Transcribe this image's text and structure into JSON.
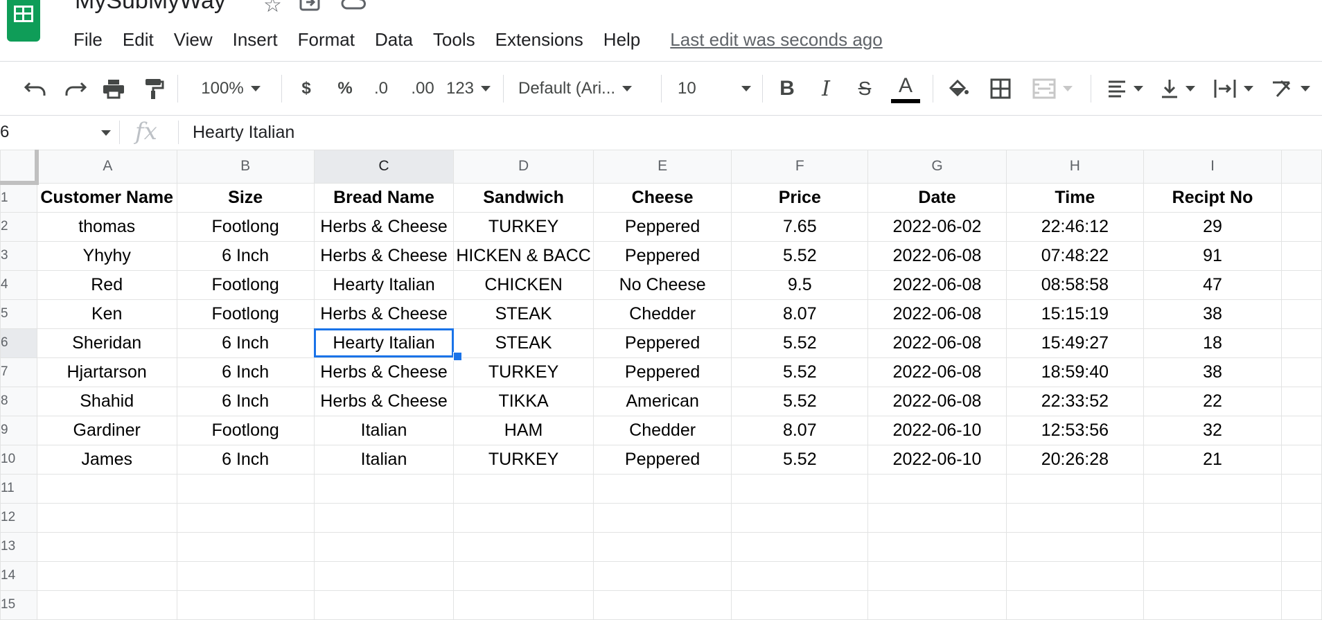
{
  "app": {
    "title": "MySubMyWay",
    "menu": [
      "File",
      "Edit",
      "View",
      "Insert",
      "Format",
      "Data",
      "Tools",
      "Extensions",
      "Help"
    ],
    "last_edit": "Last edit was seconds ago"
  },
  "toolbar": {
    "zoom": "100%",
    "currency": "$",
    "percent": "%",
    "decrease_decimal": ".0",
    "increase_decimal": ".00",
    "more_formats": "123",
    "font": "Default (Ari...",
    "font_size": "10",
    "bold": "B",
    "italic": "I",
    "strikethrough": "S",
    "text_color": "A"
  },
  "formula_bar": {
    "cell_ref": "6",
    "fx": "fx",
    "value": "Hearty Italian"
  },
  "grid": {
    "columns": [
      "A",
      "B",
      "C",
      "D",
      "E",
      "F",
      "G",
      "H",
      "I"
    ],
    "selected_column": "C",
    "selected_row": "6",
    "row_numbers": [
      "1",
      "2",
      "3",
      "4",
      "5",
      "6",
      "7",
      "8",
      "9",
      "10",
      "11",
      "12",
      "13",
      "14",
      "15"
    ],
    "rows": [
      [
        "Customer Name",
        "Size",
        "Bread Name",
        "Sandwich",
        "Cheese",
        "Price",
        "Date",
        "Time",
        "Recipt No"
      ],
      [
        "thomas",
        "Footlong",
        "Herbs & Cheese",
        "TURKEY",
        "Peppered",
        "7.65",
        "2022-06-02",
        "22:46:12",
        "29"
      ],
      [
        "Yhyhy",
        "6 Inch",
        "Herbs & Cheese",
        "HICKEN & BACC",
        "Peppered",
        "5.52",
        "2022-06-08",
        "07:48:22",
        "91"
      ],
      [
        "Red",
        "Footlong",
        "Hearty Italian",
        "CHICKEN",
        "No Cheese",
        "9.5",
        "2022-06-08",
        "08:58:58",
        "47"
      ],
      [
        "Ken",
        "Footlong",
        "Herbs & Cheese",
        "STEAK",
        "Chedder",
        "8.07",
        "2022-06-08",
        "15:15:19",
        "38"
      ],
      [
        "Sheridan",
        "6 Inch",
        "Hearty Italian",
        "STEAK",
        "Peppered",
        "5.52",
        "2022-06-08",
        "15:49:27",
        "18"
      ],
      [
        "Hjartarson",
        "6 Inch",
        "Herbs & Cheese",
        "TURKEY",
        "Peppered",
        "5.52",
        "2022-06-08",
        "18:59:40",
        "38"
      ],
      [
        "Shahid",
        "6 Inch",
        "Herbs & Cheese",
        "TIKKA",
        "American",
        "5.52",
        "2022-06-08",
        "22:33:52",
        "22"
      ],
      [
        "Gardiner",
        "Footlong",
        "Italian",
        "HAM",
        "Chedder",
        "8.07",
        "2022-06-10",
        "12:53:56",
        "32"
      ],
      [
        "James",
        "6 Inch",
        "Italian",
        "TURKEY",
        "Peppered",
        "5.52",
        "2022-06-10",
        "20:26:28",
        "21"
      ],
      [
        "",
        "",
        "",
        "",
        "",
        "",
        "",
        "",
        ""
      ],
      [
        "",
        "",
        "",
        "",
        "",
        "",
        "",
        "",
        ""
      ],
      [
        "",
        "",
        "",
        "",
        "",
        "",
        "",
        "",
        ""
      ],
      [
        "",
        "",
        "",
        "",
        "",
        "",
        "",
        "",
        ""
      ],
      [
        "",
        "",
        "",
        "",
        "",
        "",
        "",
        "",
        ""
      ]
    ]
  },
  "colors": {
    "accent": "#1a73e8",
    "sheets_green": "#0f9d58"
  }
}
